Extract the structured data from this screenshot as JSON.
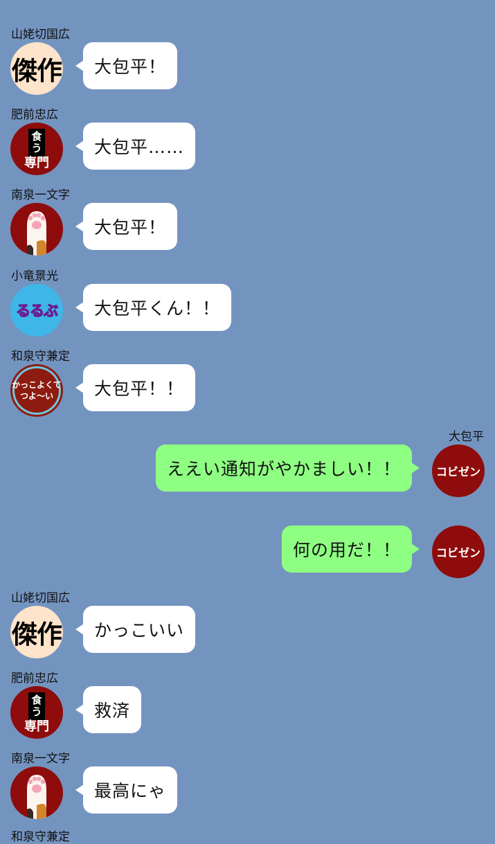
{
  "avatars": {
    "kessaku": "傑作",
    "kusenmon_top": [
      "食",
      "う"
    ],
    "kusenmon_bottom": "専門",
    "rurubu": "るるぶ",
    "kakko_line1": "かっこよくて",
    "kakko_line2": "つよ〜い",
    "kobizen": "コビゼン"
  },
  "messages": [
    {
      "sender": "山姥切国広",
      "text": "大包平！"
    },
    {
      "sender": "肥前忠広",
      "text": "大包平……"
    },
    {
      "sender": "南泉一文字",
      "text": "大包平！"
    },
    {
      "sender": "小竜景光",
      "text": "大包平くん！！"
    },
    {
      "sender": "和泉守兼定",
      "text": "大包平！！"
    },
    {
      "sender": "大包平",
      "text": "ええい通知がやかましい！！"
    },
    {
      "sender": "",
      "text": "何の用だ！！"
    },
    {
      "sender": "山姥切国広",
      "text": "かっこいい"
    },
    {
      "sender": "肥前忠広",
      "text": "救済"
    },
    {
      "sender": "南泉一文字",
      "text": "最高にゃ"
    },
    {
      "sender": "和泉守兼定",
      "text": ""
    }
  ]
}
